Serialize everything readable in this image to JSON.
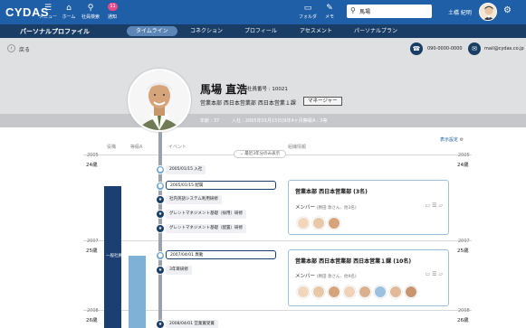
{
  "app": {
    "logo": "CYDAS"
  },
  "topnav": [
    {
      "label": "メニュー",
      "icon": "menu-icon"
    },
    {
      "label": "ホーム",
      "icon": "home-icon"
    },
    {
      "label": "社員検索",
      "icon": "people-search-icon"
    },
    {
      "label": "通知",
      "icon": "bell-icon",
      "badge": "11"
    },
    {
      "label": "フォルダ",
      "icon": "folder-icon"
    },
    {
      "label": "メモ",
      "icon": "memo-icon"
    }
  ],
  "search": {
    "value": "馬場"
  },
  "user": {
    "name": "土橋 紀明"
  },
  "section_title": "パーソナルプロファイル",
  "tabs": [
    {
      "label": "タイムライン",
      "active": true
    },
    {
      "label": "コネクション",
      "active": false
    },
    {
      "label": "プロフィール",
      "active": false
    },
    {
      "label": "アセスメント",
      "active": false
    },
    {
      "label": "パーソナルプラン",
      "active": false
    }
  ],
  "back_label": "戻る",
  "contact": {
    "phone": "090-0000-0000",
    "mail": "mail@cydas.co.jp"
  },
  "profile": {
    "name": "馬場 直浩",
    "employee_no": "社員番号 : 10021",
    "department": "営業本部 西日本営業部 西日本営業１課",
    "role": "マネージャー"
  },
  "info_strip": {
    "age": "年齢 : 37",
    "joined": "入社 : 2005年01月15日(9年4ヶ月)",
    "grade": "等級A : 3等"
  },
  "timeline": {
    "display_settings": "表示設定",
    "col_headers": [
      "役職",
      "等級A",
      "イベント",
      "組織情報"
    ],
    "pill": "最近3年分のみ表示",
    "years": [
      {
        "year": "2005",
        "age": "24歳"
      },
      {
        "year": "2007",
        "age": "25歳"
      },
      {
        "year": "2008",
        "age": "26歳"
      }
    ],
    "bar_label": "一般社員",
    "events": [
      {
        "text": "2005/01/15 入社",
        "icon": "location-icon",
        "style": "plain"
      },
      {
        "text": "2005/01/15 配属",
        "icon": "location-icon",
        "style": "outlined"
      },
      {
        "text": "社内英語システム利用研修",
        "icon": "star-icon",
        "style": "plain"
      },
      {
        "text": "グレントマネジメント基礎（採用）研修",
        "icon": "star-icon",
        "style": "plain"
      },
      {
        "text": "グレントマネジメント基礎（配置）研修",
        "icon": "star-icon",
        "style": "plain"
      },
      {
        "text": "2007/04/01 異動",
        "icon": "location-icon",
        "style": "outlined"
      },
      {
        "text": "3年目研修",
        "icon": "star-icon",
        "style": "plain"
      },
      {
        "text": "2008/04/01 営業賞受賞",
        "icon": "star-icon",
        "style": "plain"
      }
    ],
    "cards": [
      {
        "title": "営業本部 西日本営業部 (3名)",
        "members_label": "メンバー",
        "members_sub": "(勝田 敦さん、他3名)",
        "faces": 3
      },
      {
        "title": "営業本部 西日本営業部 西日本営業１課 (10名)",
        "members_label": "メンバー",
        "members_sub": "(勝田 敦さん、他9名)",
        "faces": 8
      }
    ]
  }
}
